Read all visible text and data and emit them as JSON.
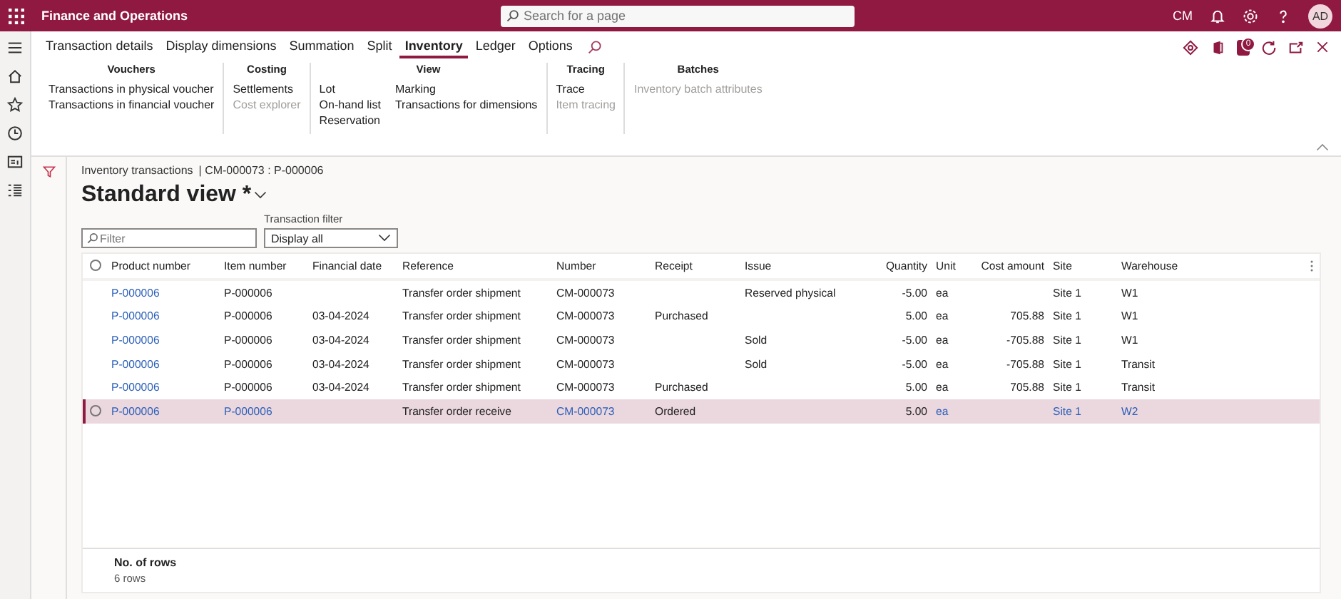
{
  "top_bar": {
    "app_title": "Finance and Operations",
    "search": {
      "placeholder": "Search for a page"
    },
    "company": "CM",
    "avatar": "AD"
  },
  "action_pane": {
    "tabs": [
      {
        "label": "Transaction details",
        "selected": false
      },
      {
        "label": "Display dimensions",
        "selected": false
      },
      {
        "label": "Summation",
        "selected": false
      },
      {
        "label": "Split",
        "selected": false
      },
      {
        "label": "Inventory",
        "selected": true
      },
      {
        "label": "Ledger",
        "selected": false
      },
      {
        "label": "Options",
        "selected": false
      }
    ],
    "notification_count": "0",
    "groups": [
      {
        "title": "Vouchers",
        "columns": [
          [
            {
              "label": "Transactions in physical voucher",
              "disabled": false
            },
            {
              "label": "Transactions in financial voucher",
              "disabled": false
            }
          ]
        ]
      },
      {
        "title": "Costing",
        "columns": [
          [
            {
              "label": "Settlements",
              "disabled": false
            },
            {
              "label": "Cost explorer",
              "disabled": true
            }
          ]
        ]
      },
      {
        "title": "View",
        "columns": [
          [
            {
              "label": "Lot",
              "disabled": false
            },
            {
              "label": "On-hand list",
              "disabled": false
            },
            {
              "label": "Reservation",
              "disabled": false
            }
          ],
          [
            {
              "label": "Marking",
              "disabled": false
            },
            {
              "label": "Transactions for dimensions",
              "disabled": false
            }
          ]
        ]
      },
      {
        "title": "Tracing",
        "columns": [
          [
            {
              "label": "Trace",
              "disabled": false
            },
            {
              "label": "Item tracing",
              "disabled": true
            }
          ]
        ]
      },
      {
        "title": "Batches",
        "columns": [
          [
            {
              "label": "Inventory batch attributes",
              "disabled": true
            }
          ]
        ]
      }
    ]
  },
  "page": {
    "breadcrumb": "Inventory transactions",
    "record": "| CM-000073 : P-000006",
    "view_title": "Standard view *",
    "filter": {
      "placeholder": "Filter"
    },
    "transaction_filter": {
      "label": "Transaction filter",
      "value": "Display all"
    }
  },
  "table": {
    "all_selected": false,
    "columns": [
      {
        "label": "Product number",
        "kind": "link"
      },
      {
        "label": "Item number",
        "kind": "lookup"
      },
      {
        "label": "Financial date",
        "kind": "text"
      },
      {
        "label": "Reference",
        "kind": "text"
      },
      {
        "label": "Number",
        "kind": "lookup"
      },
      {
        "label": "Receipt",
        "kind": "text"
      },
      {
        "label": "Issue",
        "kind": "text"
      },
      {
        "label": "Quantity",
        "kind": "number"
      },
      {
        "label": "Unit",
        "kind": "lookup"
      },
      {
        "label": "Cost amount",
        "kind": "number"
      },
      {
        "label": "Site",
        "kind": "lookup"
      },
      {
        "label": "Warehouse",
        "kind": "lookup"
      }
    ],
    "rows": [
      {
        "selected": false,
        "cells": [
          "P-000006",
          "P-000006",
          "",
          "Transfer order shipment",
          "CM-000073",
          "",
          "Reserved physical",
          "-5.00",
          "ea",
          "",
          "Site 1",
          "W1"
        ]
      },
      {
        "selected": false,
        "cells": [
          "P-000006",
          "P-000006",
          "03-04-2024",
          "Transfer order shipment",
          "CM-000073",
          "Purchased",
          "",
          "5.00",
          "ea",
          "705.88",
          "Site 1",
          "W1"
        ]
      },
      {
        "selected": false,
        "cells": [
          "P-000006",
          "P-000006",
          "03-04-2024",
          "Transfer order shipment",
          "CM-000073",
          "",
          "Sold",
          "-5.00",
          "ea",
          "-705.88",
          "Site 1",
          "W1"
        ]
      },
      {
        "selected": false,
        "cells": [
          "P-000006",
          "P-000006",
          "03-04-2024",
          "Transfer order shipment",
          "CM-000073",
          "",
          "Sold",
          "-5.00",
          "ea",
          "-705.88",
          "Site 1",
          "Transit"
        ]
      },
      {
        "selected": false,
        "cells": [
          "P-000006",
          "P-000006",
          "03-04-2024",
          "Transfer order shipment",
          "CM-000073",
          "Purchased",
          "",
          "5.00",
          "ea",
          "705.88",
          "Site 1",
          "Transit"
        ]
      },
      {
        "selected": true,
        "cells": [
          "P-000006",
          "P-000006",
          "",
          "Transfer order receive",
          "CM-000073",
          "Ordered",
          "",
          "5.00",
          "ea",
          "",
          "Site 1",
          "W2"
        ]
      }
    ],
    "footer": {
      "label": "No. of rows",
      "value": "6 rows"
    }
  }
}
